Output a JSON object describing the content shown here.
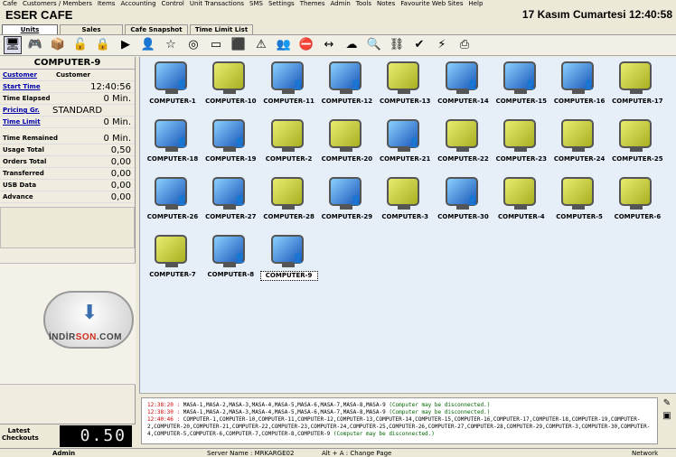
{
  "menu": [
    "Cafe",
    "Customers / Members",
    "Items",
    "Accounting",
    "Control",
    "Unit Transactions",
    "SMS",
    "Settings",
    "Themes",
    "Admin",
    "Tools",
    "Notes",
    "Favourite Web Sites",
    "Help"
  ],
  "app_title": "ESER CAFE",
  "datetime": "17 Kasım Cumartesi  12:40:58",
  "tabs": [
    "Units",
    "Sales",
    "Cafe Snapshot",
    "Time Limit List"
  ],
  "toolbar_icons": [
    "monitor-icon",
    "gamepad-icon",
    "package-icon",
    "unlock-icon",
    "lock-icon",
    "play-icon",
    "user-icon",
    "star-icon",
    "disc-icon",
    "note-icon",
    "computer-icon",
    "warning-icon",
    "users-icon",
    "stop-icon",
    "user-transfer-icon",
    "cloud-icon",
    "search-icon",
    "network-icon",
    "checkmark-icon",
    "alert-icon",
    "printer-icon"
  ],
  "left": {
    "computer": "COMPUTER-9",
    "customer_label": "Customer",
    "customer_value": "Customer",
    "start_time_label": "Start Time",
    "start_time": "12:40:56",
    "time_elapsed_label": "Time Elapsed",
    "time_elapsed": "0 Min.",
    "pricing_label": "Pricing Gr.",
    "pricing": "STANDARD",
    "time_limit_label": "Time Limit",
    "time_limit": "0 Min.",
    "time_remained_label": "Time Remained",
    "time_remained": "0 Min.",
    "usage_total_label": "Usage Total",
    "usage_total": "0,50",
    "orders_total_label": "Orders Total",
    "orders_total": "0,00",
    "transferred_label": "Transferred",
    "transferred": "0,00",
    "usb_label": "USB Data",
    "usb": "0,00",
    "advance_label": "Advance",
    "advance": "0,00",
    "latest_label": "Latest Checkouts",
    "latest_value": "0.50"
  },
  "watermark": {
    "brand_a": "İNDİR",
    "brand_b": "SON",
    "brand_c": ".COM"
  },
  "computers": [
    {
      "name": "COMPUTER-1",
      "status": "blue-user"
    },
    {
      "name": "COMPUTER-10",
      "status": "yellow"
    },
    {
      "name": "COMPUTER-11",
      "status": "blue-user"
    },
    {
      "name": "COMPUTER-12",
      "status": "blue-user"
    },
    {
      "name": "COMPUTER-13",
      "status": "yellow"
    },
    {
      "name": "COMPUTER-14",
      "status": "blue-user"
    },
    {
      "name": "COMPUTER-15",
      "status": "blue-user"
    },
    {
      "name": "COMPUTER-16",
      "status": "blue-user"
    },
    {
      "name": "COMPUTER-17",
      "status": "yellow"
    },
    {
      "name": "COMPUTER-18",
      "status": "blue-user"
    },
    {
      "name": "COMPUTER-19",
      "status": "blue-user"
    },
    {
      "name": "COMPUTER-2",
      "status": "yellow"
    },
    {
      "name": "COMPUTER-20",
      "status": "yellow"
    },
    {
      "name": "COMPUTER-21",
      "status": "blue-user"
    },
    {
      "name": "COMPUTER-22",
      "status": "yellow"
    },
    {
      "name": "COMPUTER-23",
      "status": "yellow"
    },
    {
      "name": "COMPUTER-24",
      "status": "yellow"
    },
    {
      "name": "COMPUTER-25",
      "status": "yellow"
    },
    {
      "name": "COMPUTER-26",
      "status": "blue-user"
    },
    {
      "name": "COMPUTER-27",
      "status": "blue-user"
    },
    {
      "name": "COMPUTER-28",
      "status": "yellow"
    },
    {
      "name": "COMPUTER-29",
      "status": "blue-user"
    },
    {
      "name": "COMPUTER-3",
      "status": "yellow"
    },
    {
      "name": "COMPUTER-30",
      "status": "blue-user"
    },
    {
      "name": "COMPUTER-4",
      "status": "yellow"
    },
    {
      "name": "COMPUTER-5",
      "status": "yellow"
    },
    {
      "name": "COMPUTER-6",
      "status": "yellow"
    },
    {
      "name": "COMPUTER-7",
      "status": "yellow"
    },
    {
      "name": "COMPUTER-8",
      "status": "blue-user"
    },
    {
      "name": "COMPUTER-9",
      "status": "blue-user",
      "selected": true
    }
  ],
  "log": [
    {
      "time": "12:38:20 :",
      "text": "MASA-1,MASA-2,MASA-3,MASA-4,MASA-5,MASA-6,MASA-7,MASA-8,MASA-9",
      "warn": "(Computer may be disconnected.)"
    },
    {
      "time": "12:38:30 :",
      "text": "MASA-1,MASA-2,MASA-3,MASA-4,MASA-5,MASA-6,MASA-7,MASA-8,MASA-9",
      "warn": "(Computer may be disconnected.)"
    },
    {
      "time": "12:40:46 :",
      "text": "COMPUTER-1,COMPUTER-10,COMPUTER-11,COMPUTER-12,COMPUTER-13,COMPUTER-14,COMPUTER-15,COMPUTER-16,COMPUTER-17,COMPUTER-18,COMPUTER-19,COMPUTER-2,COMPUTER-20,COMPUTER-21,COMPUTER-22,COMPUTER-23,COMPUTER-24,COMPUTER-25,COMPUTER-26,COMPUTER-27,COMPUTER-28,COMPUTER-29,COMPUTER-3,COMPUTER-30,COMPUTER-4,COMPUTER-5,COMPUTER-6,COMPUTER-7,COMPUTER-8,COMPUTER-9",
      "warn": "(Computer may be disconnected.)"
    }
  ],
  "status": {
    "user": "Admin",
    "server": "Server Name : MRKARGE02",
    "hint": "Alt + A : Change Page",
    "network": "Network"
  }
}
